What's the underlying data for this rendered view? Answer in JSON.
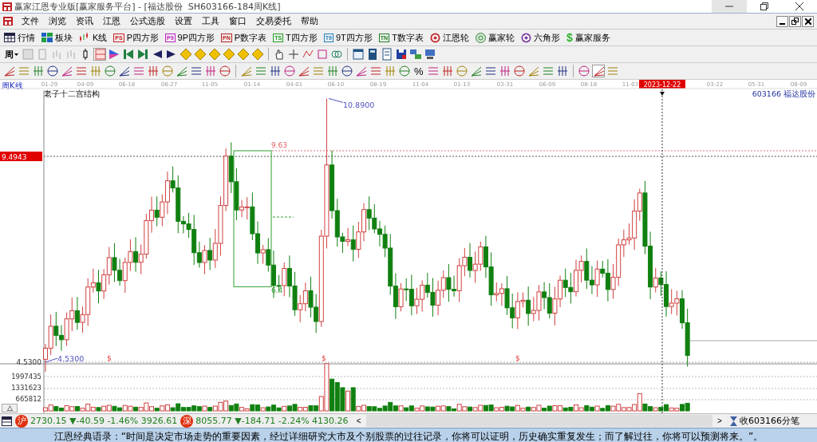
{
  "window": {
    "title": "赢家江恩专业版[赢家服务平台] - [福达股份  SH603166-184周K线]"
  },
  "menu": [
    "文件",
    "浏览",
    "资讯",
    "江恩",
    "公式选股",
    "设置",
    "工具",
    "窗口",
    "交易委托",
    "帮助"
  ],
  "toolbar": [
    {
      "label": "行情"
    },
    {
      "label": "板块"
    },
    {
      "label": "K线"
    },
    {
      "label": "P四方形",
      "badge": "PS"
    },
    {
      "label": "9P四方形",
      "badge": "P9"
    },
    {
      "label": "P数字表",
      "badge": "PN"
    },
    {
      "label": "T四方形",
      "badge": "TS"
    },
    {
      "label": "9T四方形",
      "badge": "T9"
    },
    {
      "label": "T数字表",
      "badge": "TN"
    },
    {
      "label": "江恩轮"
    },
    {
      "label": "赢家轮"
    },
    {
      "label": "六角形"
    },
    {
      "label": "赢家服务",
      "badge": "$"
    }
  ],
  "period_selector": {
    "value": "周"
  },
  "drawing_tools": {
    "percent": "%"
  },
  "date_axis": {
    "label": "周K线",
    "dates": [
      {
        "text": "01-29",
        "kind": "tick"
      },
      {
        "text": "04-09",
        "kind": "tick"
      },
      {
        "text": "06-18",
        "kind": "tick"
      },
      {
        "text": "08-27",
        "kind": "tick"
      },
      {
        "text": "11-05",
        "kind": "tick"
      },
      {
        "text": "01-14",
        "kind": "tick"
      },
      {
        "text": "04-01",
        "kind": "tick"
      },
      {
        "text": "06-10",
        "kind": "tick"
      },
      {
        "text": "08-19",
        "kind": "tick"
      },
      {
        "text": "11-04",
        "kind": "tick"
      },
      {
        "text": "01-13",
        "kind": "tick"
      },
      {
        "text": "03-31",
        "kind": "tick"
      },
      {
        "text": "06-09",
        "kind": "tick"
      },
      {
        "text": "08-18",
        "kind": "tick"
      },
      {
        "text": "11-03",
        "kind": "tick"
      },
      {
        "text": "2023-12-22",
        "kind": "cursor"
      },
      {
        "text": "03-22",
        "kind": "tick"
      },
      {
        "text": "05-31",
        "kind": "tick"
      },
      {
        "text": "08-09",
        "kind": "tick"
      }
    ]
  },
  "chart": {
    "title": "老子十二宫结构",
    "stock": "603166 福达股份",
    "cursor_price": "9.4943",
    "box_high": "9.63",
    "box_low": "6.4",
    "peak": "10.8900",
    "low_marker": "4.5300",
    "axis_low": "4.5300",
    "signals": [
      "$",
      "$",
      "$"
    ],
    "volume_axis": [
      "1997435",
      "1331623",
      "665812"
    ],
    "collapse_button": "△"
  },
  "status_bar": {
    "indices": [
      {
        "badge": "沪",
        "text": "2730.15 ▼-40.59 -1.46% 3926.61"
      },
      {
        "badge": "深",
        "text": "8055.77 ▼-184.71 -2.24% 4130.26"
      }
    ],
    "scroll_left": "<",
    "scroll_right": ">",
    "ticker": "收603166分笔"
  },
  "quote": "江恩经典语录：“时间是决定市场走势的重要因素，经过详细研究大市及个别股票的过往记录，你将可以证明，历史确实重复发生；而了解过往，你将可以预测将来。”。"
}
